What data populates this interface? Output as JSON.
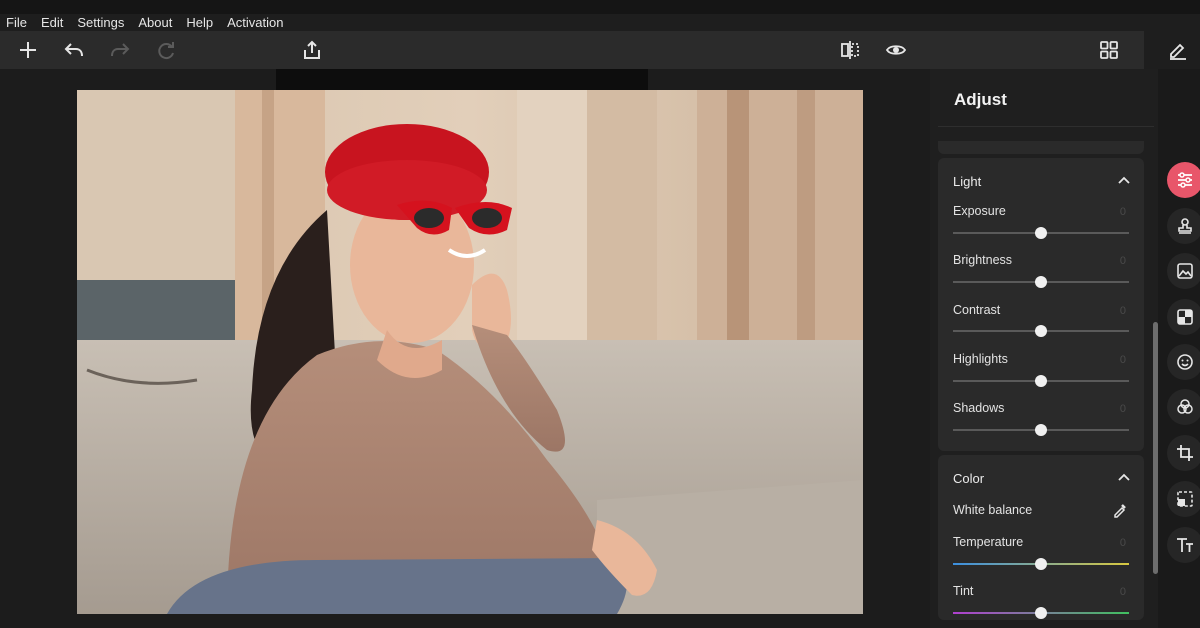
{
  "menu": [
    "File",
    "Edit",
    "Settings",
    "About",
    "Help",
    "Activation"
  ],
  "toolbar": {
    "left_icons": [
      "add-icon",
      "undo-icon",
      "redo-icon",
      "reset-icon",
      "share-icon"
    ],
    "center_icons": [
      "compare-icon",
      "preview-eye-icon"
    ],
    "right_icons": [
      "grid-icon",
      "edit-pen-icon"
    ]
  },
  "panel": {
    "title": "Adjust",
    "light": {
      "heading": "Light",
      "rows": [
        {
          "label": "Exposure",
          "value": "0",
          "level": 0.5
        },
        {
          "label": "Brightness",
          "value": "0",
          "level": 0.5
        },
        {
          "label": "Contrast",
          "value": "0",
          "level": 0.5
        },
        {
          "label": "Highlights",
          "value": "0",
          "level": 0.5
        },
        {
          "label": "Shadows",
          "value": "0",
          "level": 0.5
        }
      ]
    },
    "color": {
      "heading": "Color",
      "white_balance": "White balance",
      "rows": [
        {
          "label": "Temperature",
          "value": "0",
          "level": 0.5
        },
        {
          "label": "Tint",
          "value": "0",
          "level": 0.5
        }
      ]
    }
  },
  "rail": [
    "adjust-sliders-icon",
    "stamp-icon",
    "image-icon",
    "checker-icon",
    "emoji-icon",
    "color-circles-icon",
    "crop-icon",
    "transform-icon",
    "text-icon"
  ],
  "colors": {
    "accent": "#e8566a",
    "panel": "#2a2a2a",
    "background": "#1c1c1c"
  }
}
